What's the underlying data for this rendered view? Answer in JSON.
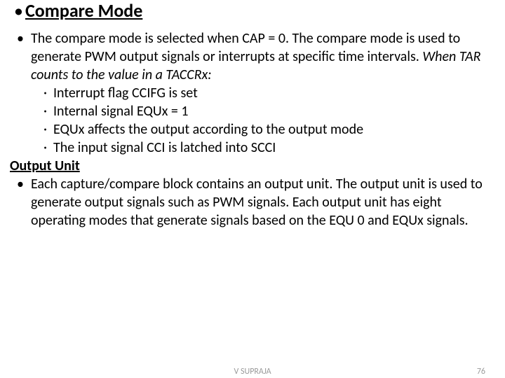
{
  "title": "Compare Mode",
  "p1_a": "The compare mode is selected when CAP = 0. The compare mode is used to generate PWM output signals or interrupts at specific time intervals. ",
  "p1_b": "When TAR counts to the value in a TACCRx:",
  "subs": [
    "Interrupt flag CCIFG is set",
    "Internal signal EQUx = 1",
    "EQUx affects the output according to the output mode",
    "The input signal CCI is latched into SCCI"
  ],
  "h2": "Output Unit",
  "p2": "Each capture/compare block contains an output unit. The output unit is used to generate output signals such as PWM signals. Each output unit has eight operating modes that generate signals based on the EQU 0 and EQUx signals.",
  "footer_center": "V SUPRAJA",
  "footer_right": "76"
}
